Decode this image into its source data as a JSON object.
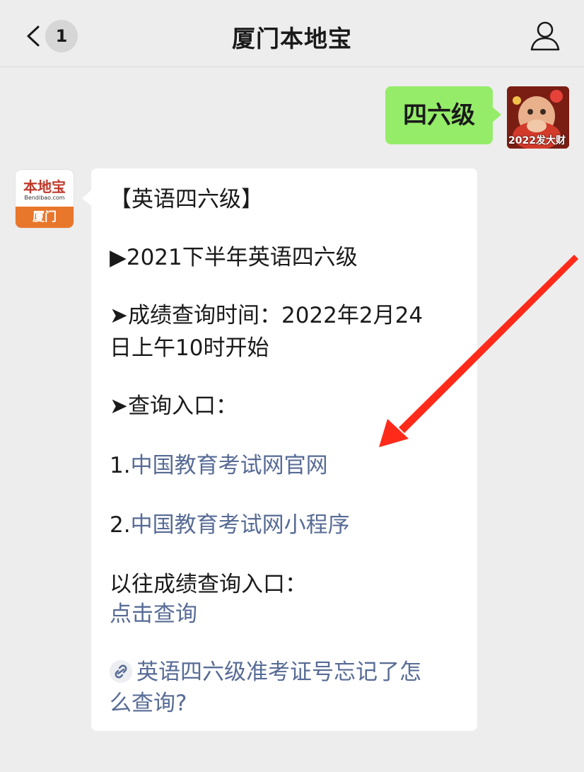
{
  "header": {
    "title": "厦门本地宝",
    "unread_count": "1",
    "back_icon": "chevron-left-icon",
    "profile_icon": "person-icon"
  },
  "sent_message": {
    "text": "四六级",
    "avatar_caption": "2022发大财"
  },
  "received_message": {
    "avatar": {
      "brand": "本地宝",
      "url": "Bendibao.com",
      "city": "厦门"
    },
    "lines": {
      "title": "【英语四六级】",
      "exam": "▶2021下半年英语四六级",
      "time_line1": "➤成绩查询时间：2022年2月24",
      "time_line2": "日上午10时开始",
      "entry_heading": "➤查询入口：",
      "entry1_prefix": "1.",
      "entry1_link": "中国教育考试网官网",
      "entry2_prefix": "2.",
      "entry2_link": "中国教育考试网小程序",
      "past_heading": "以往成绩查询入口：",
      "past_link": "点击查询",
      "miniprog_line1": "英语四六级准考证号忘记了怎",
      "miniprog_line2": "么查询?"
    }
  },
  "colors": {
    "background": "#ededed",
    "sent_bubble": "#95ec69",
    "link": "#576b95",
    "arrow": "#ff2a1a"
  }
}
